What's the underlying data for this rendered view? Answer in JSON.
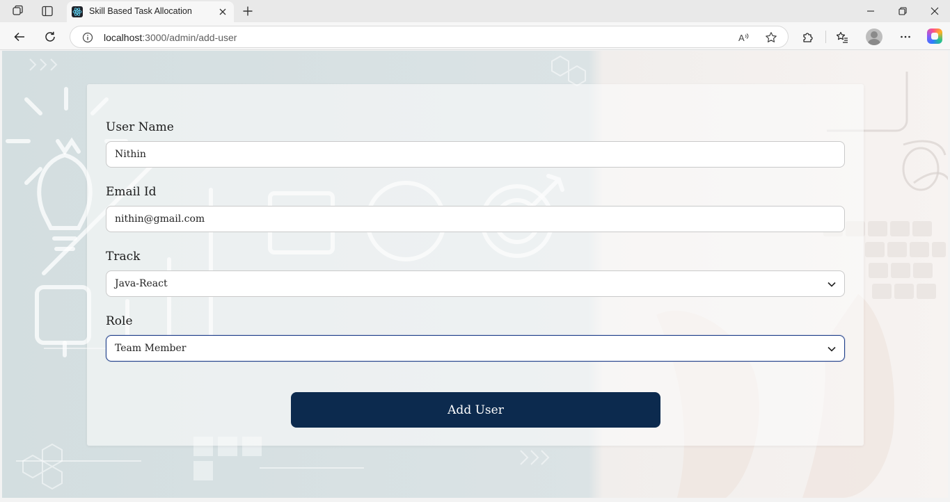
{
  "browser": {
    "tab_title": "Skill Based Task Allocation",
    "url_host": "localhost",
    "url_path": ":3000/admin/add-user"
  },
  "form": {
    "user_name": {
      "label": "User Name",
      "value": "Nithin"
    },
    "email": {
      "label": "Email Id",
      "value": "nithin@gmail.com"
    },
    "track": {
      "label": "Track",
      "value": "Java-React"
    },
    "role": {
      "label": "Role",
      "value": "Team Member"
    },
    "submit_label": "Add User"
  },
  "icons": {
    "workspaces": "workspaces-icon",
    "tab_actions": "tab-actions-icon",
    "favicon": "react-icon",
    "close": "close-icon",
    "new_tab": "plus-icon",
    "back": "back-arrow-icon",
    "refresh": "refresh-icon",
    "info": "info-icon",
    "read_aloud": "read-aloud-icon",
    "favorite": "star-icon",
    "extensions": "puzzle-icon",
    "favorites": "favorites-icon",
    "profile": "avatar",
    "more": "more-dots-icon",
    "copilot": "copilot-icon",
    "dropdown": "chevron-down-icon"
  },
  "colors": {
    "button": "#0c2a4e",
    "focus_border": "#1f3f8a"
  }
}
